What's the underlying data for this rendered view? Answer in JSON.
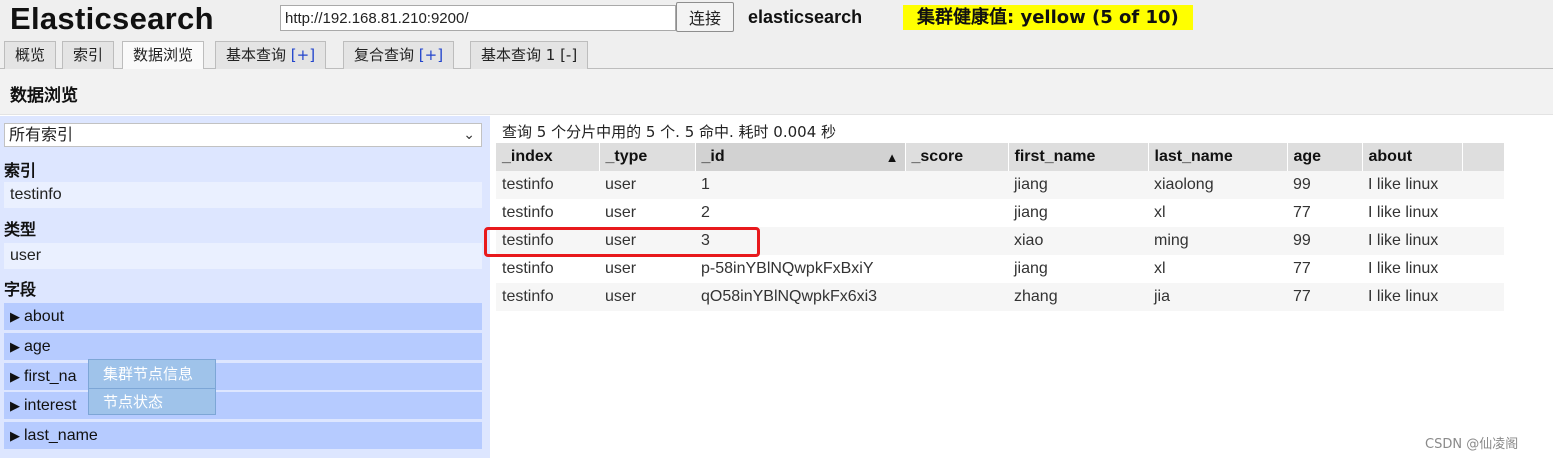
{
  "header": {
    "logo": "Elasticsearch",
    "url_value": "http://192.168.81.210:9200/",
    "connect_label": "连接",
    "cluster_name": "elasticsearch",
    "health_label": "集群健康值: yellow (5 of 10)",
    "health_color": "#ffff00"
  },
  "tabs": [
    {
      "label": "概览",
      "bracket": ""
    },
    {
      "label": "索引",
      "bracket": ""
    },
    {
      "label": "数据浏览",
      "bracket": ""
    },
    {
      "label": "基本查询 ",
      "bracket": "[+]"
    },
    {
      "label": "复合查询 ",
      "bracket": "[+]"
    },
    {
      "label": "基本查询 1 [-]",
      "bracket": ""
    }
  ],
  "section": {
    "title": "数据浏览"
  },
  "sidebar": {
    "index_select_value": "所有索引",
    "index_heading": "索引",
    "index_value": "testinfo",
    "type_heading": "类型",
    "type_value": "user",
    "fields_heading": "字段",
    "fields": [
      "about",
      "age",
      "first_na",
      "interest",
      "last_name"
    ]
  },
  "context_menu": {
    "items": [
      "集群节点信息",
      "节点状态"
    ]
  },
  "results": {
    "summary": "查询 5 个分片中用的 5 个. 5 命中. 耗时 0.004 秒",
    "columns": [
      "_index",
      "_type",
      "_id",
      "_score",
      "first_name",
      "last_name",
      "age",
      "about"
    ],
    "rows": [
      [
        "testinfo",
        "user",
        "1",
        "",
        "jiang",
        "xiaolong",
        "99",
        "I like linux"
      ],
      [
        "testinfo",
        "user",
        "2",
        "",
        "jiang",
        "xl",
        "77",
        "I like linux"
      ],
      [
        "testinfo",
        "user",
        "3",
        "",
        "xiao",
        "ming",
        "99",
        "I like linux"
      ],
      [
        "testinfo",
        "user",
        "p-58inYBlNQwpkFxBxiY",
        "",
        "jiang",
        "xl",
        "77",
        "I like linux"
      ],
      [
        "testinfo",
        "user",
        "qO58inYBlNQwpkFx6xi3",
        "",
        "zhang",
        "jia",
        "77",
        "I like linux"
      ]
    ],
    "highlight_color": "#e8191c"
  },
  "watermark": "CSDN @仙凌阁"
}
